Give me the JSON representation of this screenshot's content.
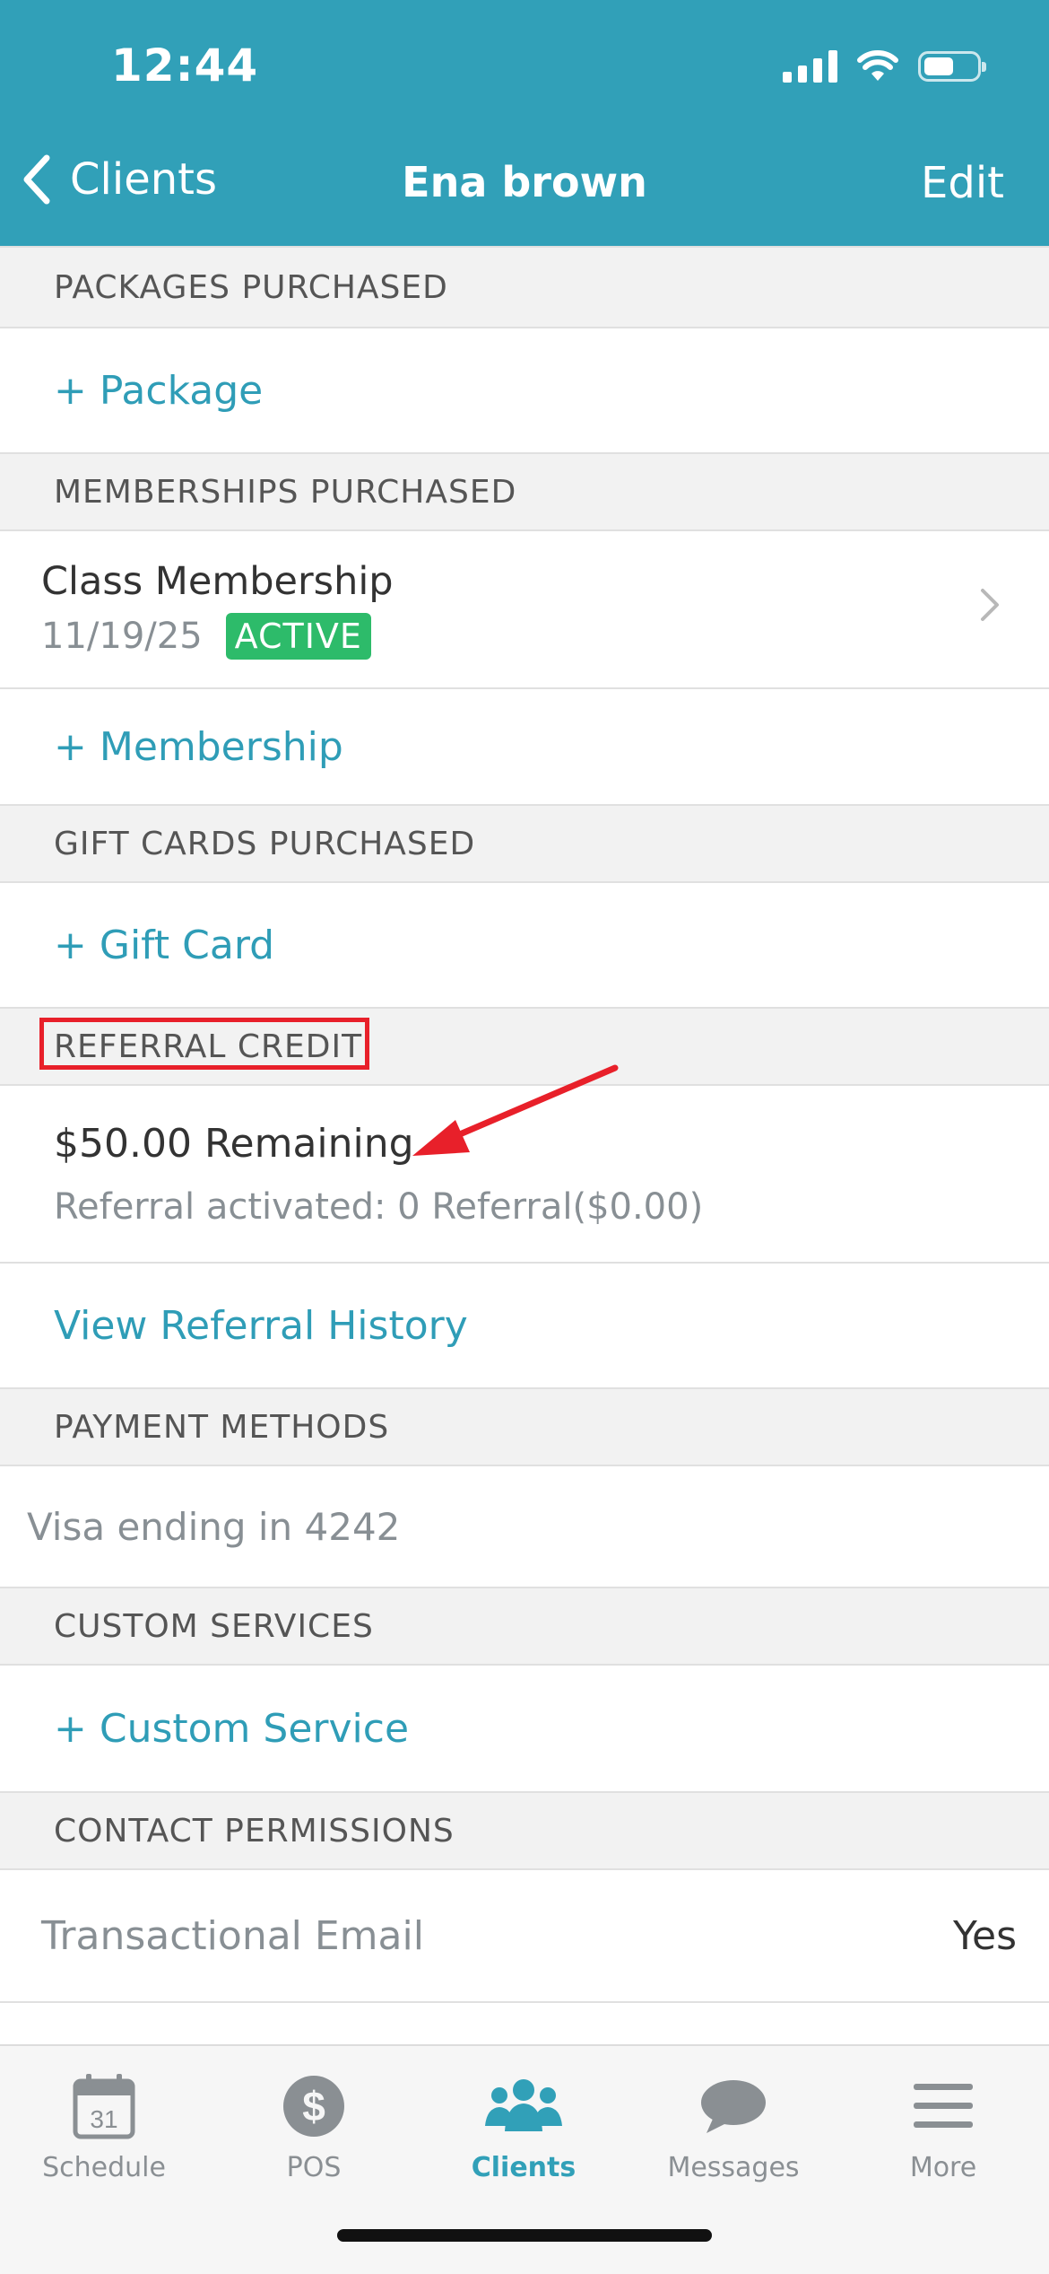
{
  "status": {
    "time": "12:44"
  },
  "nav": {
    "back_label": "Clients",
    "title": "Ena brown",
    "edit_label": "Edit"
  },
  "sections": {
    "packages": {
      "header": "PACKAGES PURCHASED",
      "add_label": "+ Package"
    },
    "memberships": {
      "header": "MEMBERSHIPS PURCHASED",
      "items": [
        {
          "name": "Class Membership",
          "date": "11/19/25",
          "status": "ACTIVE"
        }
      ],
      "add_label": "+ Membership"
    },
    "gift_cards": {
      "header": "GIFT CARDS PURCHASED",
      "add_label": "+ Gift Card"
    },
    "referral": {
      "header": "REFERRAL CREDIT",
      "remaining": "$50.00 Remaining",
      "activated": "Referral activated: 0 Referral($0.00)",
      "history_label": "View Referral History"
    },
    "payment": {
      "header": "PAYMENT METHODS",
      "method": "Visa ending in 4242"
    },
    "custom_services": {
      "header": "CUSTOM SERVICES",
      "add_label": "+ Custom Service"
    },
    "contact": {
      "header": "CONTACT PERMISSIONS",
      "items": [
        {
          "label": "Transactional Email",
          "value": "Yes"
        }
      ]
    }
  },
  "tabs": [
    {
      "label": "Schedule",
      "icon": "calendar-icon",
      "calendar_day": "31"
    },
    {
      "label": "POS",
      "icon": "dollar-icon",
      "symbol": "$"
    },
    {
      "label": "Clients",
      "icon": "people-icon",
      "active": true
    },
    {
      "label": "Messages",
      "icon": "chat-bubble-icon"
    },
    {
      "label": "More",
      "icon": "hamburger-menu-icon"
    }
  ],
  "colors": {
    "brand": "#31a0b8",
    "active_badge": "#2dbb6a",
    "annotation": "#e8202a"
  }
}
